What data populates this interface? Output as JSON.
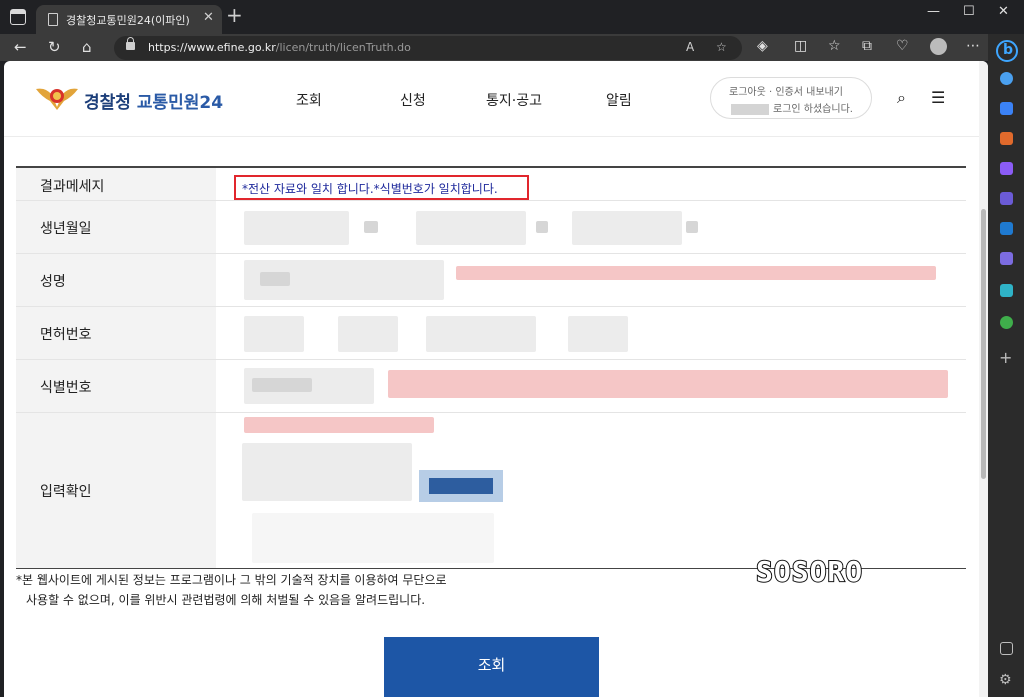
{
  "browser": {
    "tab_title": "경찰청교통민원24(이파인)",
    "url_host": "https://www.efine.go.kr",
    "url_path": "/licen/truth/licenTruth.do",
    "tab_close": "✕",
    "new_tab": "+",
    "minimize": "—",
    "maximize": "☐",
    "close": "✕"
  },
  "site": {
    "logo_org": "경찰청",
    "logo_service": "교통민원24",
    "menu": [
      "조회",
      "신청",
      "통지·공고",
      "알림"
    ],
    "login_links": "로그아웃 · 인증서 내보내기",
    "login_status": "로그인 하셨습니다."
  },
  "table": {
    "rows": [
      {
        "label": "결과메세지"
      },
      {
        "label": "생년월일"
      },
      {
        "label": "성명"
      },
      {
        "label": "면허번호"
      },
      {
        "label": "식별번호"
      },
      {
        "label": "입력확인"
      }
    ],
    "result_message": "*전산 자료와 일치 합니다.*식별번호가 일치합니다."
  },
  "notice_line1": "*본 웹사이트에 게시된 정보는 프로그램이나 그 밖의 기술적 장치를 이용하여 무단으로",
  "notice_line2": "사용할 수 없으며, 이를 위반시 관련법령에 의해 처벌될 수 있음을 알려드립니다.",
  "watermark": "SOSORO",
  "search_button": "조회",
  "icons": {
    "search": "search-icon",
    "menu": "hamburger-menu-icon"
  }
}
